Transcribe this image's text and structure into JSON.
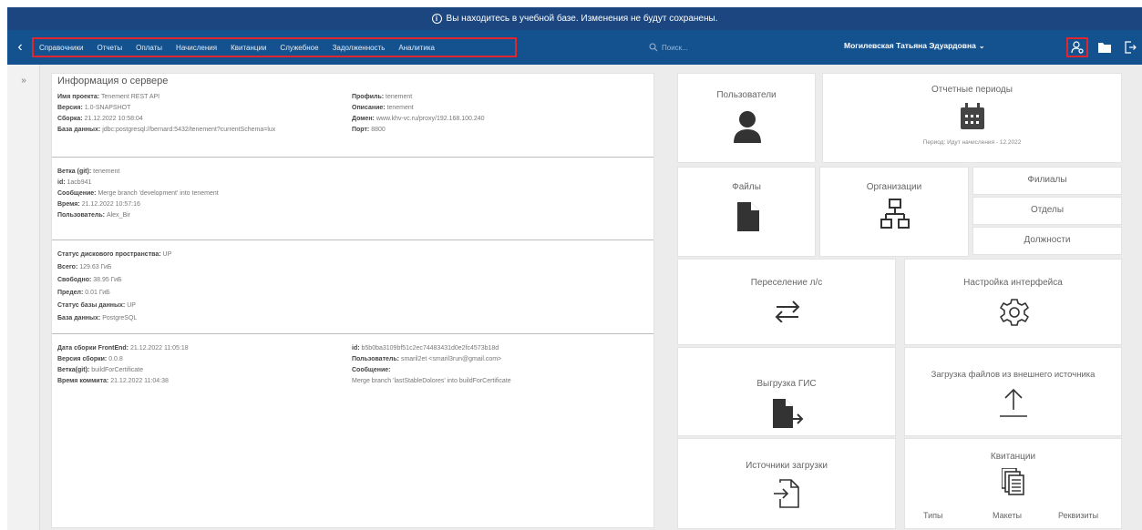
{
  "banner": {
    "text": "Вы находитесь в учебной базе. Изменения не будут сохранены."
  },
  "nav": {
    "menu": [
      "Справочники",
      "Отчеты",
      "Оплаты",
      "Начисления",
      "Квитанции",
      "Служебное",
      "Задолженность",
      "Аналитика"
    ],
    "search_placeholder": "Поиск...",
    "user_name": "Могилевская Татьяна Эдуардовна"
  },
  "info": {
    "title": "Информация о сервере",
    "s1": {
      "project_label": "Имя проекта:",
      "project": "Tenement REST API",
      "version_label": "Версия:",
      "version": "1.0-SNAPSHOT",
      "build_label": "Сборка:",
      "build": "21.12.2022 10:58:04",
      "db_label": "База данных:",
      "db": "jdbc:postgresql://bernard:5432/tenement?currentSchema=lux",
      "profile_label": "Профиль:",
      "profile": "tenement",
      "desc_label": "Описание:",
      "desc": "tenement",
      "domain_label": "Домен:",
      "domain": "www.khv-vc.ru/proxy/192.168.100.240",
      "port_label": "Порт:",
      "port": "8800"
    },
    "s2": {
      "branch_label": "Ветка (git):",
      "branch": "tenement",
      "id_label": "id:",
      "id": "1acb941",
      "msg_label": "Сообщение:",
      "msg": "Merge branch 'development' into tenement",
      "time_label": "Время:",
      "time": "21.12.2022 10:57:16",
      "user_label": "Пользователь:",
      "user": "Alex_Bir"
    },
    "s3": {
      "disk_label": "Статус дискового пространства:",
      "disk": "UP",
      "total_label": "Всего:",
      "total": "129.63 ГиБ",
      "free_label": "Свободно:",
      "free": "38.95 ГиБ",
      "limit_label": "Предел:",
      "limit": "0.01 ГиБ",
      "dbstatus_label": "Статус базы данных:",
      "dbstatus": "UP",
      "dbname_label": "База данных:",
      "dbname": "PostgreSQL"
    },
    "s4": {
      "fe_date_label": "Дата сборки FrontEnd:",
      "fe_date": "21.12.2022 11:05:18",
      "build_ver_label": "Версия сборки:",
      "build_ver": "0.0.8",
      "git_branch_label": "Ветка(git):",
      "git_branch": "buildForCertificate",
      "commit_time_label": "Время коммита:",
      "commit_time": "21.12.2022 11:04:38",
      "id_label": "id:",
      "id": "b5b0ba3109bf51c2ec74483431d0e2fc4573b18d",
      "user_label": "Пользователь:",
      "user": "smaril2et <smaril3run@gmail.com>",
      "msg_label": "Сообщение:",
      "msg": "Merge branch 'lastStableDolores' into buildForCertificate"
    }
  },
  "tiles": {
    "users": "Пользователи",
    "periods": "Отчетные периоды",
    "period_info": "Период: Идут начисления - 12.2022",
    "files": "Файлы",
    "orgs": "Организации",
    "branches": "Филиалы",
    "departments": "Отделы",
    "positions": "Должности",
    "resettle": "Переселение л/с",
    "ui_settings": "Настройка интерфейса",
    "gis_export": "Выгрузка ГИС",
    "external_load": "Загрузка файлов из внешнего источника",
    "load_sources": "Источники загрузки",
    "receipts": "Квитанции",
    "types": "Типы",
    "layouts": "Макеты",
    "requisites": "Реквизиты"
  },
  "colors": {
    "banner": "#1b467f",
    "nav": "#14528f",
    "highlight": "#e0262f",
    "icon": "#333333"
  }
}
